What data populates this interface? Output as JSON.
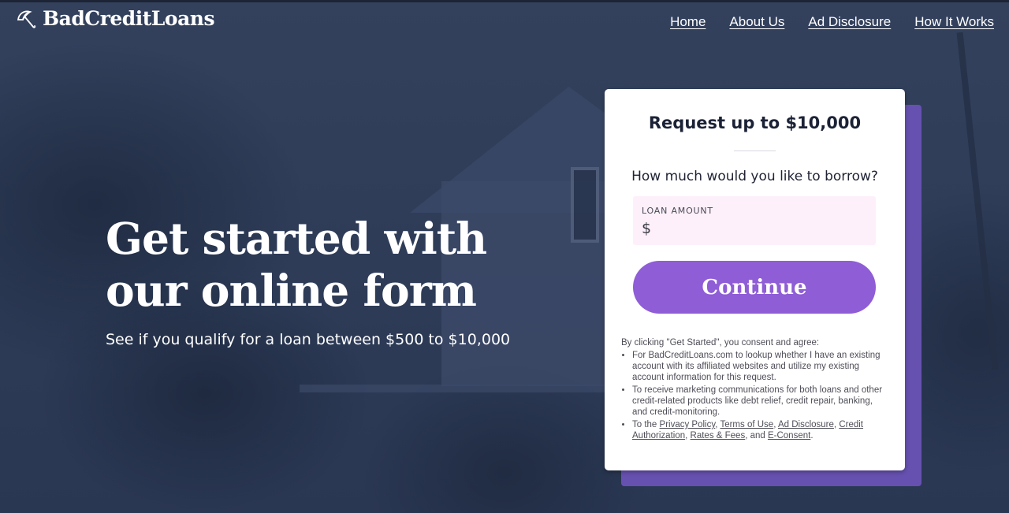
{
  "brand": {
    "name": "BadCreditLoans",
    "icon": "umbrella-icon"
  },
  "nav": [
    {
      "label": "Home"
    },
    {
      "label": "About Us"
    },
    {
      "label": "Ad Disclosure"
    },
    {
      "label": "How It Works"
    }
  ],
  "hero": {
    "title": "Get started with our online form",
    "subtitle": "See if you qualify for a loan between $500 to $10,000"
  },
  "form": {
    "title": "Request up to $10,000",
    "question": "How much would you like to borrow?",
    "amount_label": "LOAN AMOUNT",
    "amount_prefix": "$",
    "amount_value": "",
    "continue_label": "Continue",
    "colors": {
      "button": "#8f5dd6",
      "shadow": "#6651b0",
      "input_bg": "#fdf0fb"
    }
  },
  "consent": {
    "intro": "By clicking \"Get Started\", you consent and agree:",
    "item1": "For BadCreditLoans.com to lookup whether I have an existing account with its affiliated websites and utilize my existing account information for this request.",
    "item2": "To receive marketing communications for both loans and other credit-related products like debt relief, credit repair, banking, and credit-monitoring.",
    "item3_prefix": "To the",
    "links": {
      "privacy": "Privacy Policy",
      "terms": "Terms of Use",
      "ad": "Ad Disclosure",
      "credit": "Credit Authorization",
      "rates": "Rates & Fees",
      "econsent": "E-Consent"
    },
    "sep_comma": ",",
    "sep_and": ", and",
    "end": "."
  }
}
